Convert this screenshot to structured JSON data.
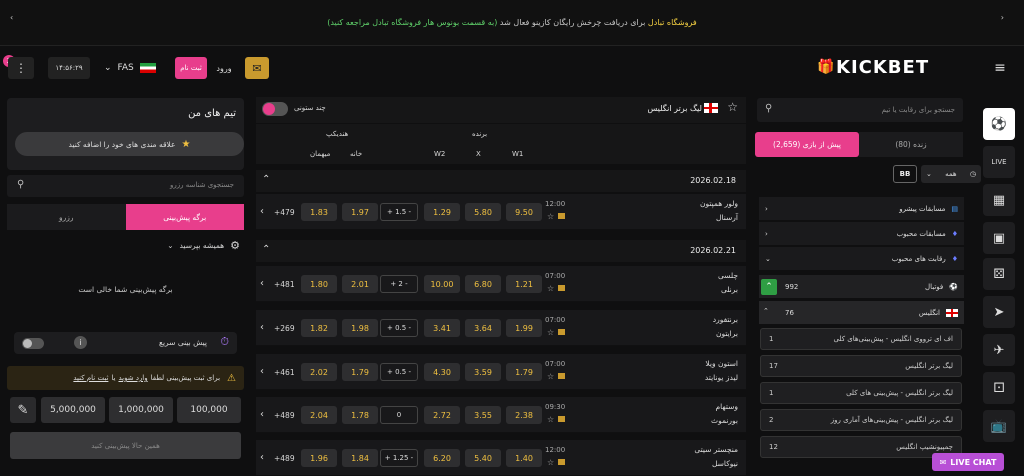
{
  "promo": {
    "highlight": "فروشگاه تبادل",
    "text1": " برای دریافت چرخش رایگان کازینو فعال شد ",
    "text2": "(به قسمت بونوس هار فروشگاه تبادل مراجعه کنید)"
  },
  "header": {
    "badge": "2",
    "clock": "۱۴:۵۶:۲۹",
    "lang": "FAS",
    "register": "ثبت نام",
    "login": "ورود",
    "logo": "KICKBET"
  },
  "left": {
    "my_teams_title": "تیم های من",
    "add_fav": "علاقه مندی های خود را اضافه کنید",
    "search_placeholder": "جستجوی شناسه رزرو",
    "tab_slip": "برگه پیش‌بینی",
    "tab_reserve": "رزرو",
    "always_accept": "همیشه بپرسید",
    "empty": "برگه پیش‌بینی شما خالی است",
    "quick_bet": "پیش بینی سریع",
    "warn_text": "برای ثبت پیش‌بینی لطفا",
    "warn_login": "وارد شوید",
    "warn_or": "یا",
    "warn_reg": "ثبت نام کنید",
    "stakes": [
      "5,000,000",
      "1,000,000",
      "100,000"
    ],
    "place": "همین حالا پیش‌بینی کنید"
  },
  "center": {
    "league": "لیگ برتر انگلیس",
    "multi": "چند ستونی",
    "col_winner": "برنده",
    "col_handicap": "هندیکپ",
    "w2": "W2",
    "x": "X",
    "w1": "W1",
    "home": "خانه",
    "away": "میهمان",
    "dates": [
      "2026.02.18",
      "2026.02.21"
    ],
    "matches": [
      {
        "home": "ولور همپتون",
        "away": "آرسنال",
        "time": "12:00",
        "w1": "9.50",
        "x": "5.80",
        "w2": "1.29",
        "hcp": "+ 1.5 -",
        "h1": "1.97",
        "h2": "1.83",
        "more": "+479"
      },
      {
        "home": "چلسی",
        "away": "برنلی",
        "time": "07:00",
        "w1": "1.21",
        "x": "6.80",
        "w2": "10.00",
        "hcp": "+ 2 -",
        "h1": "2.01",
        "h2": "1.80",
        "more": "+481"
      },
      {
        "home": "برنتفورد",
        "away": "برایتون",
        "time": "07:00",
        "w1": "1.99",
        "x": "3.64",
        "w2": "3.41",
        "hcp": "+ 0.5 -",
        "h1": "1.98",
        "h2": "1.82",
        "more": "+269"
      },
      {
        "home": "استون ویلا",
        "away": "لیدز یونایتد",
        "time": "07:00",
        "w1": "1.79",
        "x": "3.59",
        "w2": "4.30",
        "hcp": "+ 0.5 -",
        "h1": "1.79",
        "h2": "2.02",
        "more": "+461"
      },
      {
        "home": "وستهام",
        "away": "بورنموث",
        "time": "09:30",
        "w1": "2.38",
        "x": "3.55",
        "w2": "2.72",
        "hcp": "0",
        "h1": "1.78",
        "h2": "2.04",
        "more": "+489"
      },
      {
        "home": "منچستر سیتی",
        "away": "نیوکاسل",
        "time": "12:00",
        "w1": "1.40",
        "x": "5.40",
        "w2": "6.20",
        "hcp": "+ 1.25 -",
        "h1": "1.84",
        "h2": "1.96",
        "more": "+489"
      }
    ]
  },
  "right": {
    "search_placeholder": "جستجو برای رقابت یا تیم",
    "tab_pre": "پیش از بازی (2,659)",
    "tab_live": "زنده (80)",
    "bb": "BB",
    "all": "همه",
    "menu": [
      "مسابقات پیشرو",
      "مسابقات محبوب",
      "رقابت های محبوب"
    ],
    "football": "فوتبال",
    "football_count": "992",
    "england": "انگلیس",
    "england_count": "76",
    "leagues": [
      {
        "name": "اف ای ترووی انگلیس - پیش‌بینی‌های کلی",
        "count": "1"
      },
      {
        "name": "لیگ برتر انگلیس",
        "count": "17"
      },
      {
        "name": "لیگ برتر انگلیس - پیش‌بینی های کلی",
        "count": "1"
      },
      {
        "name": "لیگ برتر انگلیس - پیش‌بینی‌های آماری روز",
        "count": "2"
      },
      {
        "name": "چمپیونشیپ انگلیس",
        "count": "12"
      }
    ]
  },
  "live_chat": "LIVE CHAT"
}
